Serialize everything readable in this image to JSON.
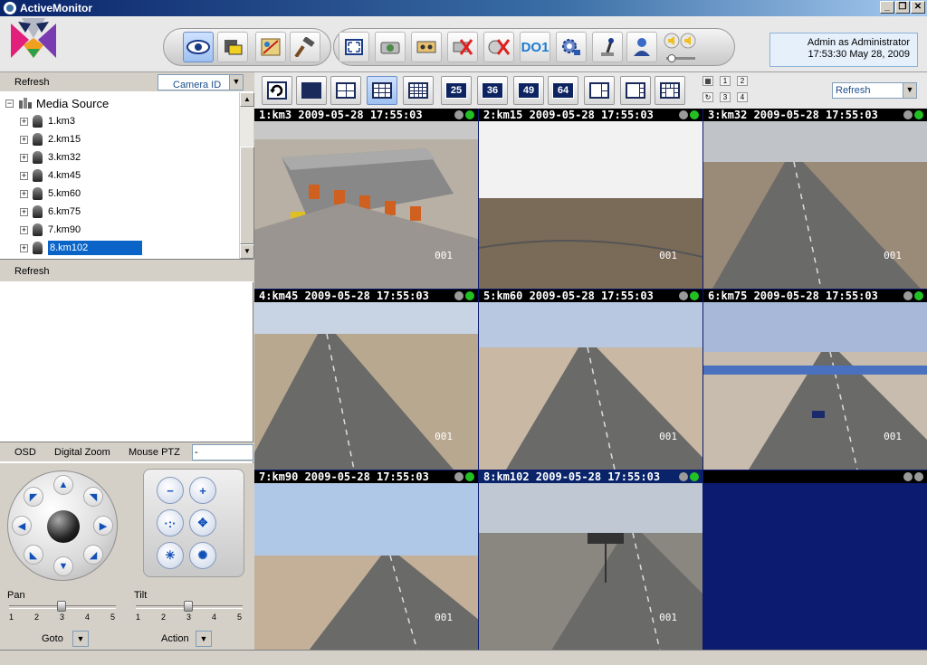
{
  "window": {
    "title": "ActiveMonitor",
    "min": "_",
    "max": "❐",
    "close": "✕"
  },
  "status": {
    "user": "Admin as Administrator",
    "datetime": "17:53:30 May 28, 2009"
  },
  "toolbar": {
    "do_label": "DO1"
  },
  "left": {
    "refresh_top": "Refresh",
    "filter_select": "Camera ID",
    "tree_root": "Media Source",
    "cameras": [
      "1.km3",
      "2.km15",
      "3.km32",
      "4.km45",
      "5.km60",
      "6.km75",
      "7.km90",
      "8.km102"
    ],
    "refresh_bottom": "Refresh"
  },
  "ptz": {
    "tab_osd": "OSD",
    "tab_zoom": "Digital Zoom",
    "tab_mouse": "Mouse PTZ",
    "mouse_value": "-",
    "pan_label": "Pan",
    "tilt_label": "Tilt",
    "ticks": [
      "1",
      "2",
      "3",
      "4",
      "5"
    ],
    "pan_value": 3,
    "tilt_value": 3,
    "goto_label": "Goto",
    "action_label": "Action"
  },
  "video_toolbar": {
    "refresh_select": "Refresh",
    "layout_numbers": [
      "25",
      "36",
      "49",
      "64"
    ],
    "mini_layouts": [
      "1",
      "2",
      "3",
      "4"
    ]
  },
  "tiles": [
    {
      "title": "1:km3   2009-05-28 17:55:03",
      "wm": "001"
    },
    {
      "title": "2:km15  2009-05-28 17:55:03",
      "wm": "001"
    },
    {
      "title": "3:km32  2009-05-28 17:55:03",
      "wm": "001"
    },
    {
      "title": "4:km45  2009-05-28 17:55:03",
      "wm": "001"
    },
    {
      "title": "5:km60  2009-05-28 17:55:03",
      "wm": "001"
    },
    {
      "title": "6:km75  2009-05-28 17:55:03",
      "wm": "001"
    },
    {
      "title": "7:km90  2009-05-28 17:55:03",
      "wm": "001"
    },
    {
      "title": "8:km102 2009-05-28 17:55:03",
      "wm": "001"
    },
    {
      "title": "",
      "wm": ""
    }
  ],
  "colors": {
    "video_bg": "#0c1a70",
    "selection": "#0a64c8",
    "status_ok": "#22c022",
    "status_off": "#9a9a9a"
  }
}
